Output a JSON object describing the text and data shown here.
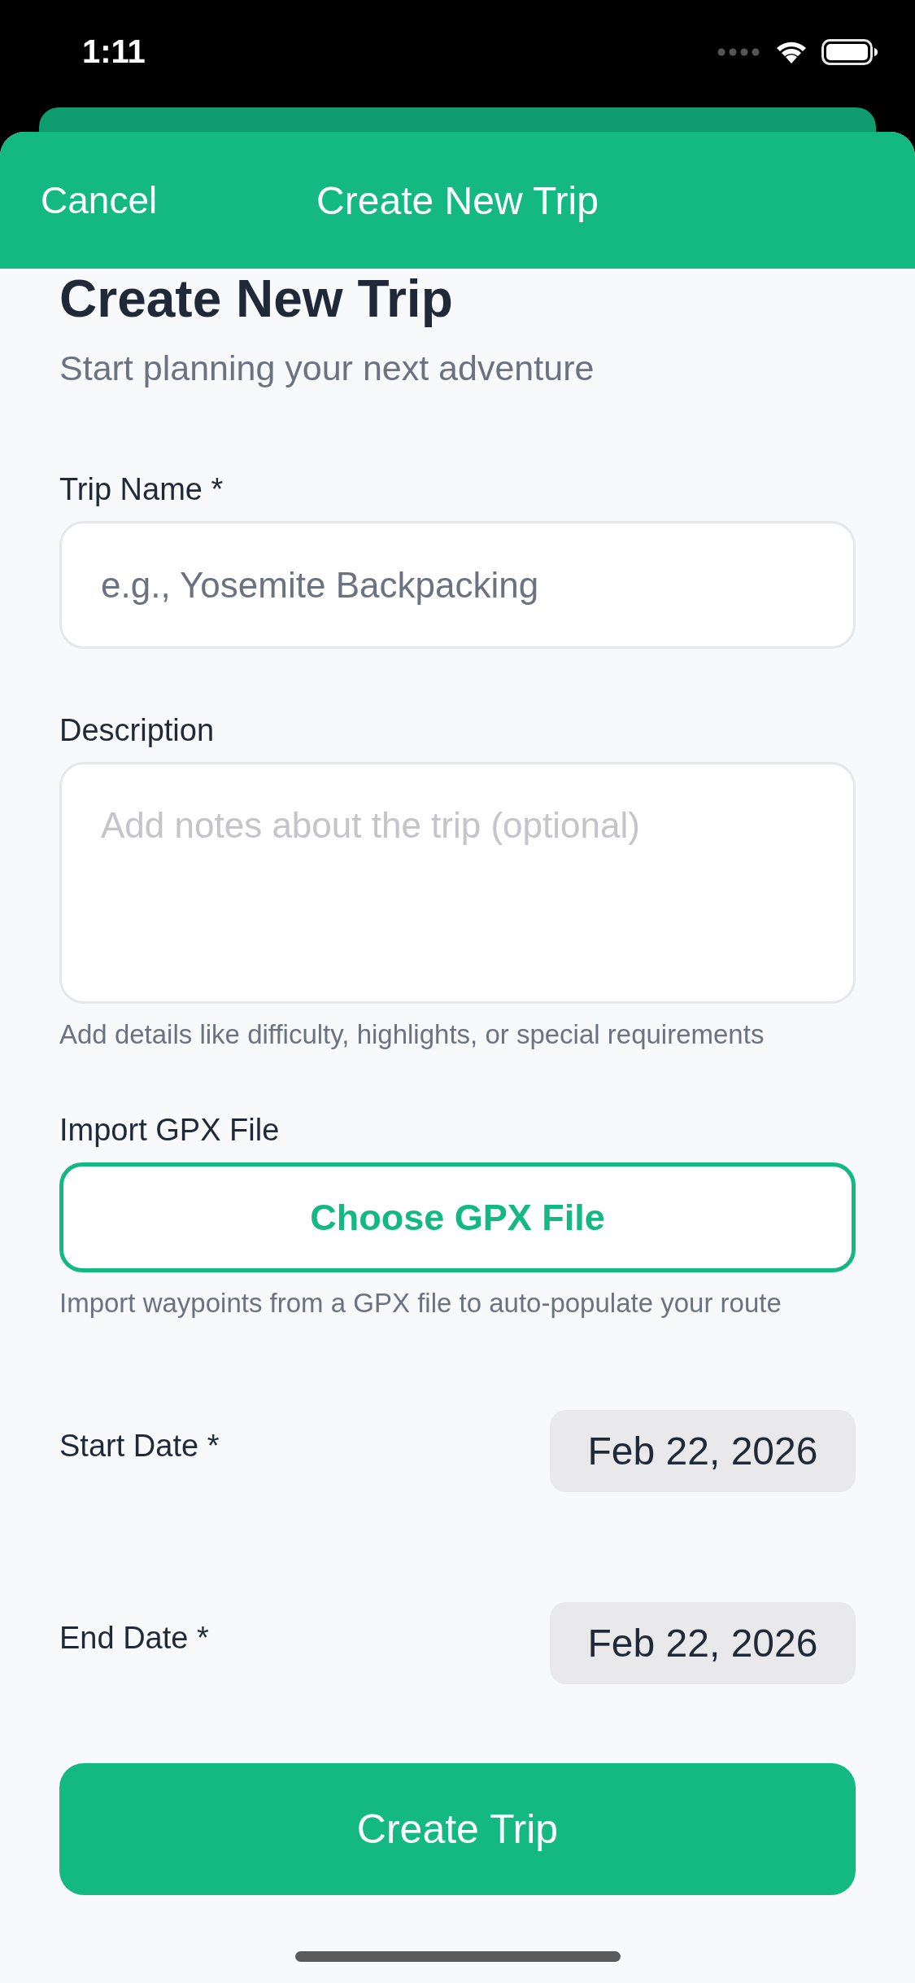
{
  "status_bar": {
    "time": "1:11"
  },
  "header": {
    "cancel": "Cancel",
    "title": "Create New Trip"
  },
  "heading": {
    "title": "Create New Trip",
    "subtitle": "Start planning your next adventure"
  },
  "fields": [
    {
      "kind": "input",
      "label": "Trip Name *",
      "placeholder": "e.g., Yosemite Backpacking"
    },
    {
      "kind": "textarea",
      "label": "Description",
      "placeholder": "Add notes about the trip (optional)",
      "help": "Add details like difficulty, highlights, or special requirements"
    },
    {
      "kind": "file",
      "label": "Import GPX File",
      "button": "Choose GPX File",
      "help": "Import waypoints from a GPX file to auto-populate your route"
    },
    {
      "kind": "date",
      "label": "Start Date *",
      "value": "Feb 22, 2026"
    },
    {
      "kind": "date",
      "label": "End Date *",
      "value": "Feb 22, 2026"
    }
  ],
  "submit": "Create Trip"
}
